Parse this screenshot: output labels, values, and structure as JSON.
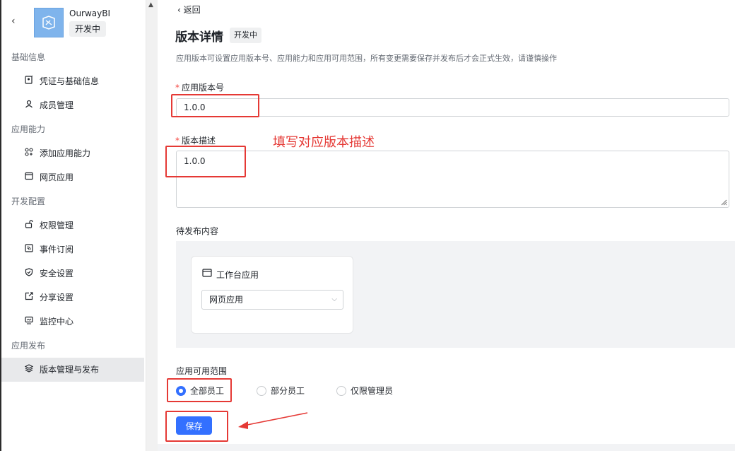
{
  "sidebar": {
    "app_name": "OurwayBI",
    "status": "开发中",
    "groups": [
      {
        "title": "基础信息",
        "items": [
          {
            "label": "凭证与基础信息",
            "icon": "credential-icon"
          },
          {
            "label": "成员管理",
            "icon": "person-icon"
          }
        ]
      },
      {
        "title": "应用能力",
        "items": [
          {
            "label": "添加应用能力",
            "icon": "grid-plus-icon"
          },
          {
            "label": "网页应用",
            "icon": "browser-window-icon"
          }
        ]
      },
      {
        "title": "开发配置",
        "items": [
          {
            "label": "权限管理",
            "icon": "unlock-icon"
          },
          {
            "label": "事件订阅",
            "icon": "rss-icon"
          },
          {
            "label": "安全设置",
            "icon": "shield-icon"
          },
          {
            "label": "分享设置",
            "icon": "share-icon"
          },
          {
            "label": "监控中心",
            "icon": "monitor-icon"
          }
        ]
      },
      {
        "title": "应用发布",
        "items": [
          {
            "label": "版本管理与发布",
            "icon": "layers-icon",
            "active": true
          }
        ]
      }
    ]
  },
  "main": {
    "back": "返回",
    "title": "版本详情",
    "title_tag": "开发中",
    "description": "应用版本可设置应用版本号、应用能力和应用可用范围，所有变更需要保存并发布后才会正式生效，请谨慎操作",
    "version_label": "应用版本号",
    "version_value": "1.0.0",
    "desc_label": "版本描述",
    "desc_value": "1.0.0",
    "annotation": "填写对应版本描述",
    "pending_label": "待发布内容",
    "card_title": "工作台应用",
    "card_select_value": "网页应用",
    "scope_label": "应用可用范围",
    "scope_options": [
      {
        "label": "全部员工",
        "checked": true
      },
      {
        "label": "部分员工",
        "checked": false
      },
      {
        "label": "仅限管理员",
        "checked": false
      }
    ],
    "save_label": "保存"
  },
  "colors": {
    "accent": "#3370ff",
    "annotation_red": "#e53935",
    "required": "#f54a45"
  }
}
